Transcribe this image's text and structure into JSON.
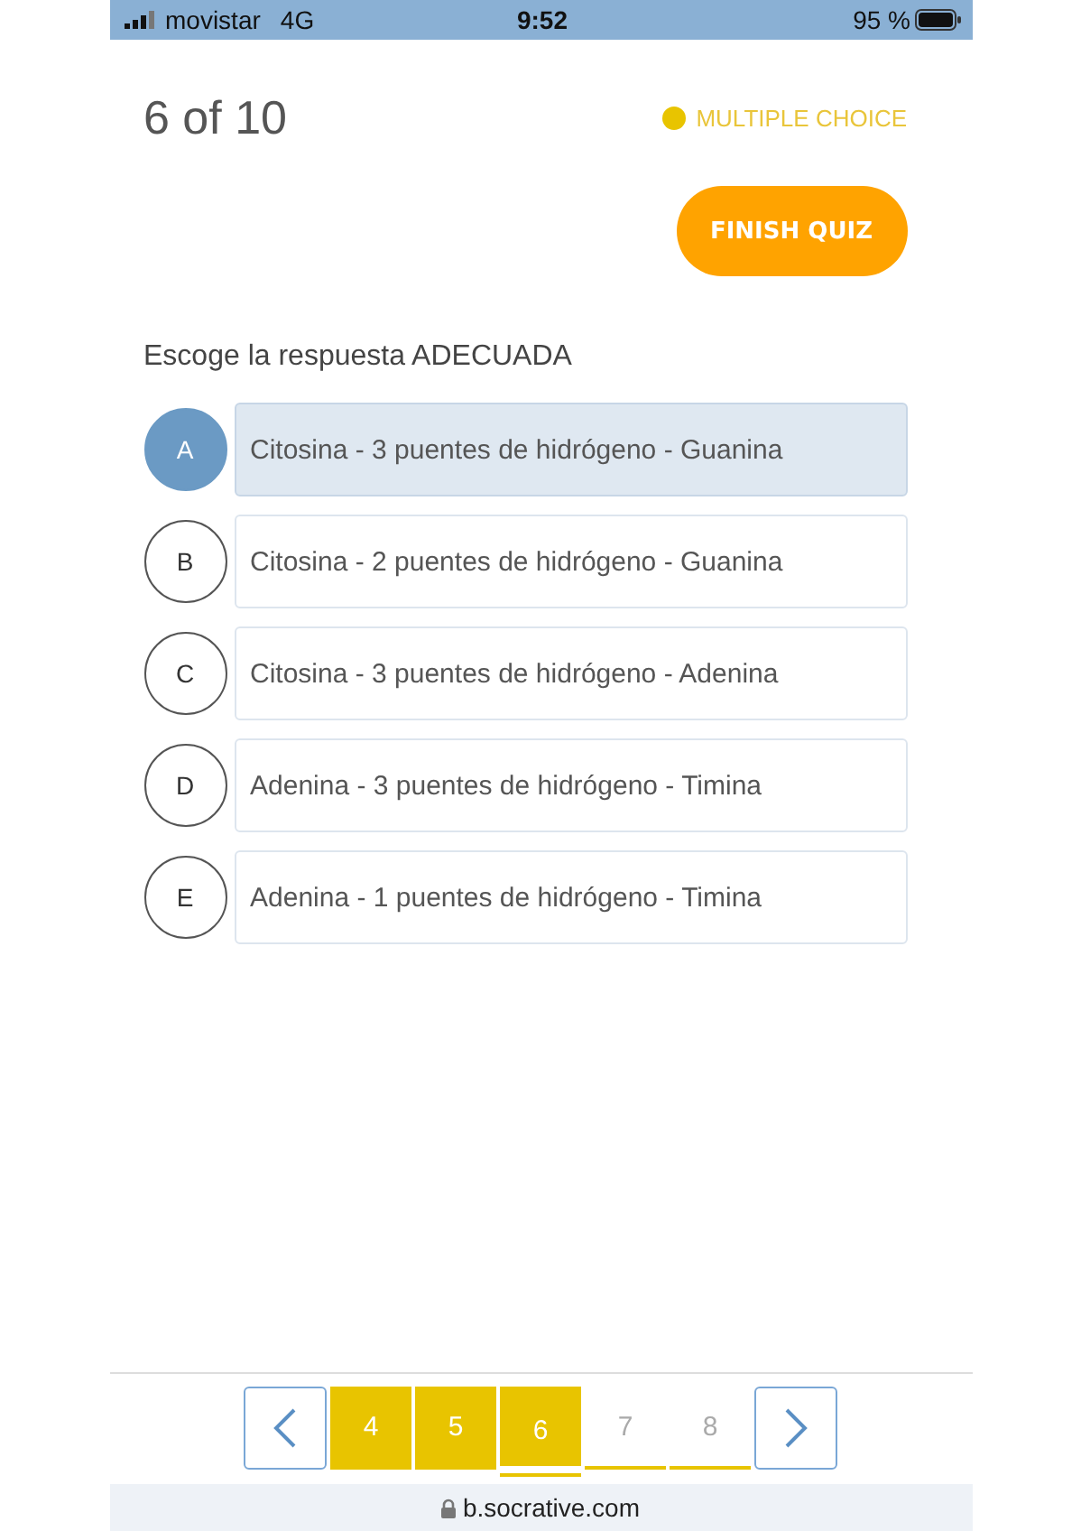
{
  "status_bar": {
    "carrier": "movistar",
    "network": "4G",
    "time": "9:52",
    "battery": "95 %"
  },
  "progress": "6 of 10",
  "question_type": "MULTIPLE CHOICE",
  "finish_button": "FINISH QUIZ",
  "question": "Escoge la respuesta ADECUADA",
  "options": [
    {
      "letter": "A",
      "text": "Citosina - 3 puentes de hidrógeno - Guanina",
      "selected": true
    },
    {
      "letter": "B",
      "text": "Citosina - 2 puentes de hidrógeno - Guanina",
      "selected": false
    },
    {
      "letter": "C",
      "text": "Citosina - 3 puentes de hidrógeno - Adenina",
      "selected": false
    },
    {
      "letter": "D",
      "text": "Adenina - 3 puentes de hidrógeno - Timina",
      "selected": false
    },
    {
      "letter": "E",
      "text": "Adenina - 1 puentes de hidrógeno - Timina",
      "selected": false
    }
  ],
  "pages": [
    {
      "label": "4",
      "answered": true,
      "selected": false
    },
    {
      "label": "5",
      "answered": true,
      "selected": false
    },
    {
      "label": "6",
      "answered": true,
      "selected": true
    },
    {
      "label": "7",
      "answered": false,
      "selected": false
    },
    {
      "label": "8",
      "answered": false,
      "selected": false
    }
  ],
  "url": "b.socrative.com"
}
